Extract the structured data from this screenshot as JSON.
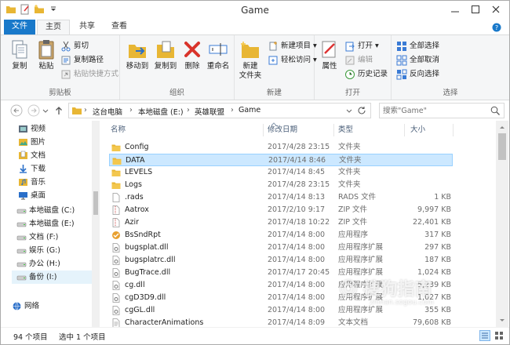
{
  "window": {
    "title": "Game",
    "colors": {
      "accent": "#1979ca",
      "selection": "#cce8ff",
      "folder": "#e8b634"
    }
  },
  "ribbon_tabs": [
    {
      "label": "文件"
    },
    {
      "label": "主页"
    },
    {
      "label": "共享"
    },
    {
      "label": "查看"
    }
  ],
  "ribbon": {
    "clipboard": {
      "label": "剪贴板",
      "copy": "复制",
      "paste": "粘贴",
      "cut": "剪切",
      "copy_path": "复制路径",
      "paste_shortcut": "粘贴快捷方式"
    },
    "organize": {
      "label": "组织",
      "move_to": "移动到",
      "copy_to": "复制到",
      "delete": "删除",
      "rename": "重命名"
    },
    "new": {
      "label": "新建",
      "new_folder": [
        "新建",
        "文件夹"
      ],
      "new_item": "新建项目 ▾",
      "easy_access": "轻松访问 ▾"
    },
    "open": {
      "label": "打开",
      "properties": "属性",
      "open": "打开 ▾",
      "edit": "编辑",
      "history": "历史记录"
    },
    "select": {
      "label": "选择",
      "select_all": "全部选择",
      "select_none": "全部取消",
      "invert": "反向选择"
    }
  },
  "address": {
    "crumbs": [
      "这台电脑",
      "本地磁盘 (E:)",
      "英雄联盟",
      "Game"
    ]
  },
  "search": {
    "placeholder": "搜索\"Game\""
  },
  "nav_pane": {
    "items": [
      {
        "label": "视频",
        "icon": "video-icon"
      },
      {
        "label": "图片",
        "icon": "picture-icon"
      },
      {
        "label": "文档",
        "icon": "document-icon"
      },
      {
        "label": "下载",
        "icon": "download-icon"
      },
      {
        "label": "音乐",
        "icon": "music-icon"
      },
      {
        "label": "桌面",
        "icon": "desktop-icon"
      },
      {
        "label": "本地磁盘 (C:)",
        "icon": "drive-icon"
      },
      {
        "label": "本地磁盘 (E:)",
        "icon": "drive-icon"
      },
      {
        "label": "文档 (F:)",
        "icon": "drive-icon"
      },
      {
        "label": "娱乐 (G:)",
        "icon": "drive-icon"
      },
      {
        "label": "办公 (H:)",
        "icon": "drive-icon"
      },
      {
        "label": "备份 (I:)",
        "icon": "drive-icon"
      },
      {
        "label": "网络",
        "icon": "network-icon"
      }
    ]
  },
  "columns": {
    "name": "名称",
    "date": "修改日期",
    "type": "类型",
    "size": "大小"
  },
  "files": [
    {
      "name": "Config",
      "date": "2017/4/28 23:15",
      "type": "文件夹",
      "size": "",
      "icon": "folder"
    },
    {
      "name": "DATA",
      "date": "2017/4/14 8:46",
      "type": "文件夹",
      "size": "",
      "icon": "folder"
    },
    {
      "name": "LEVELS",
      "date": "2017/4/14 8:45",
      "type": "文件夹",
      "size": "",
      "icon": "folder"
    },
    {
      "name": "Logs",
      "date": "2017/4/28 23:15",
      "type": "文件夹",
      "size": "",
      "icon": "folder"
    },
    {
      "name": ".rads",
      "date": "2017/4/14 8:13",
      "type": "RADS 文件",
      "size": "1 KB",
      "icon": "file"
    },
    {
      "name": "Aatrox",
      "date": "2017/2/10 9:17",
      "type": "ZIP 文件",
      "size": "9,997 KB",
      "icon": "zip"
    },
    {
      "name": "Azir",
      "date": "2017/4/18 10:22",
      "type": "ZIP 文件",
      "size": "22,401 KB",
      "icon": "zip"
    },
    {
      "name": "BsSndRpt",
      "date": "2017/4/14 8:00",
      "type": "应用程序",
      "size": "317 KB",
      "icon": "exe"
    },
    {
      "name": "bugsplat.dll",
      "date": "2017/4/14 8:00",
      "type": "应用程序扩展",
      "size": "297 KB",
      "icon": "dll"
    },
    {
      "name": "bugsplatrc.dll",
      "date": "2017/4/14 8:00",
      "type": "应用程序扩展",
      "size": "187 KB",
      "icon": "dll"
    },
    {
      "name": "BugTrace.dll",
      "date": "2017/4/17 20:45",
      "type": "应用程序扩展",
      "size": "1,024 KB",
      "icon": "dll"
    },
    {
      "name": "cg.dll",
      "date": "2017/4/14 8:00",
      "type": "应用程序扩展",
      "size": "5,239 KB",
      "icon": "dll"
    },
    {
      "name": "cgD3D9.dll",
      "date": "2017/4/14 8:00",
      "type": "应用程序扩展",
      "size": "1,027 KB",
      "icon": "dll"
    },
    {
      "name": "cgGL.dll",
      "date": "2017/4/14 8:00",
      "type": "应用程序扩展",
      "size": "355 KB",
      "icon": "dll"
    },
    {
      "name": "CharacterAnimations",
      "date": "2017/4/14 8:09",
      "type": "文本文档",
      "size": "79,608 KB",
      "icon": "txt"
    }
  ],
  "selected_file_index": 1,
  "status": {
    "count": "94 个项目",
    "selected": "选中 1 个项目"
  },
  "watermark": {
    "main": "Ⓞ 搜狗指南",
    "sub": "zhinan.sogou.com"
  }
}
